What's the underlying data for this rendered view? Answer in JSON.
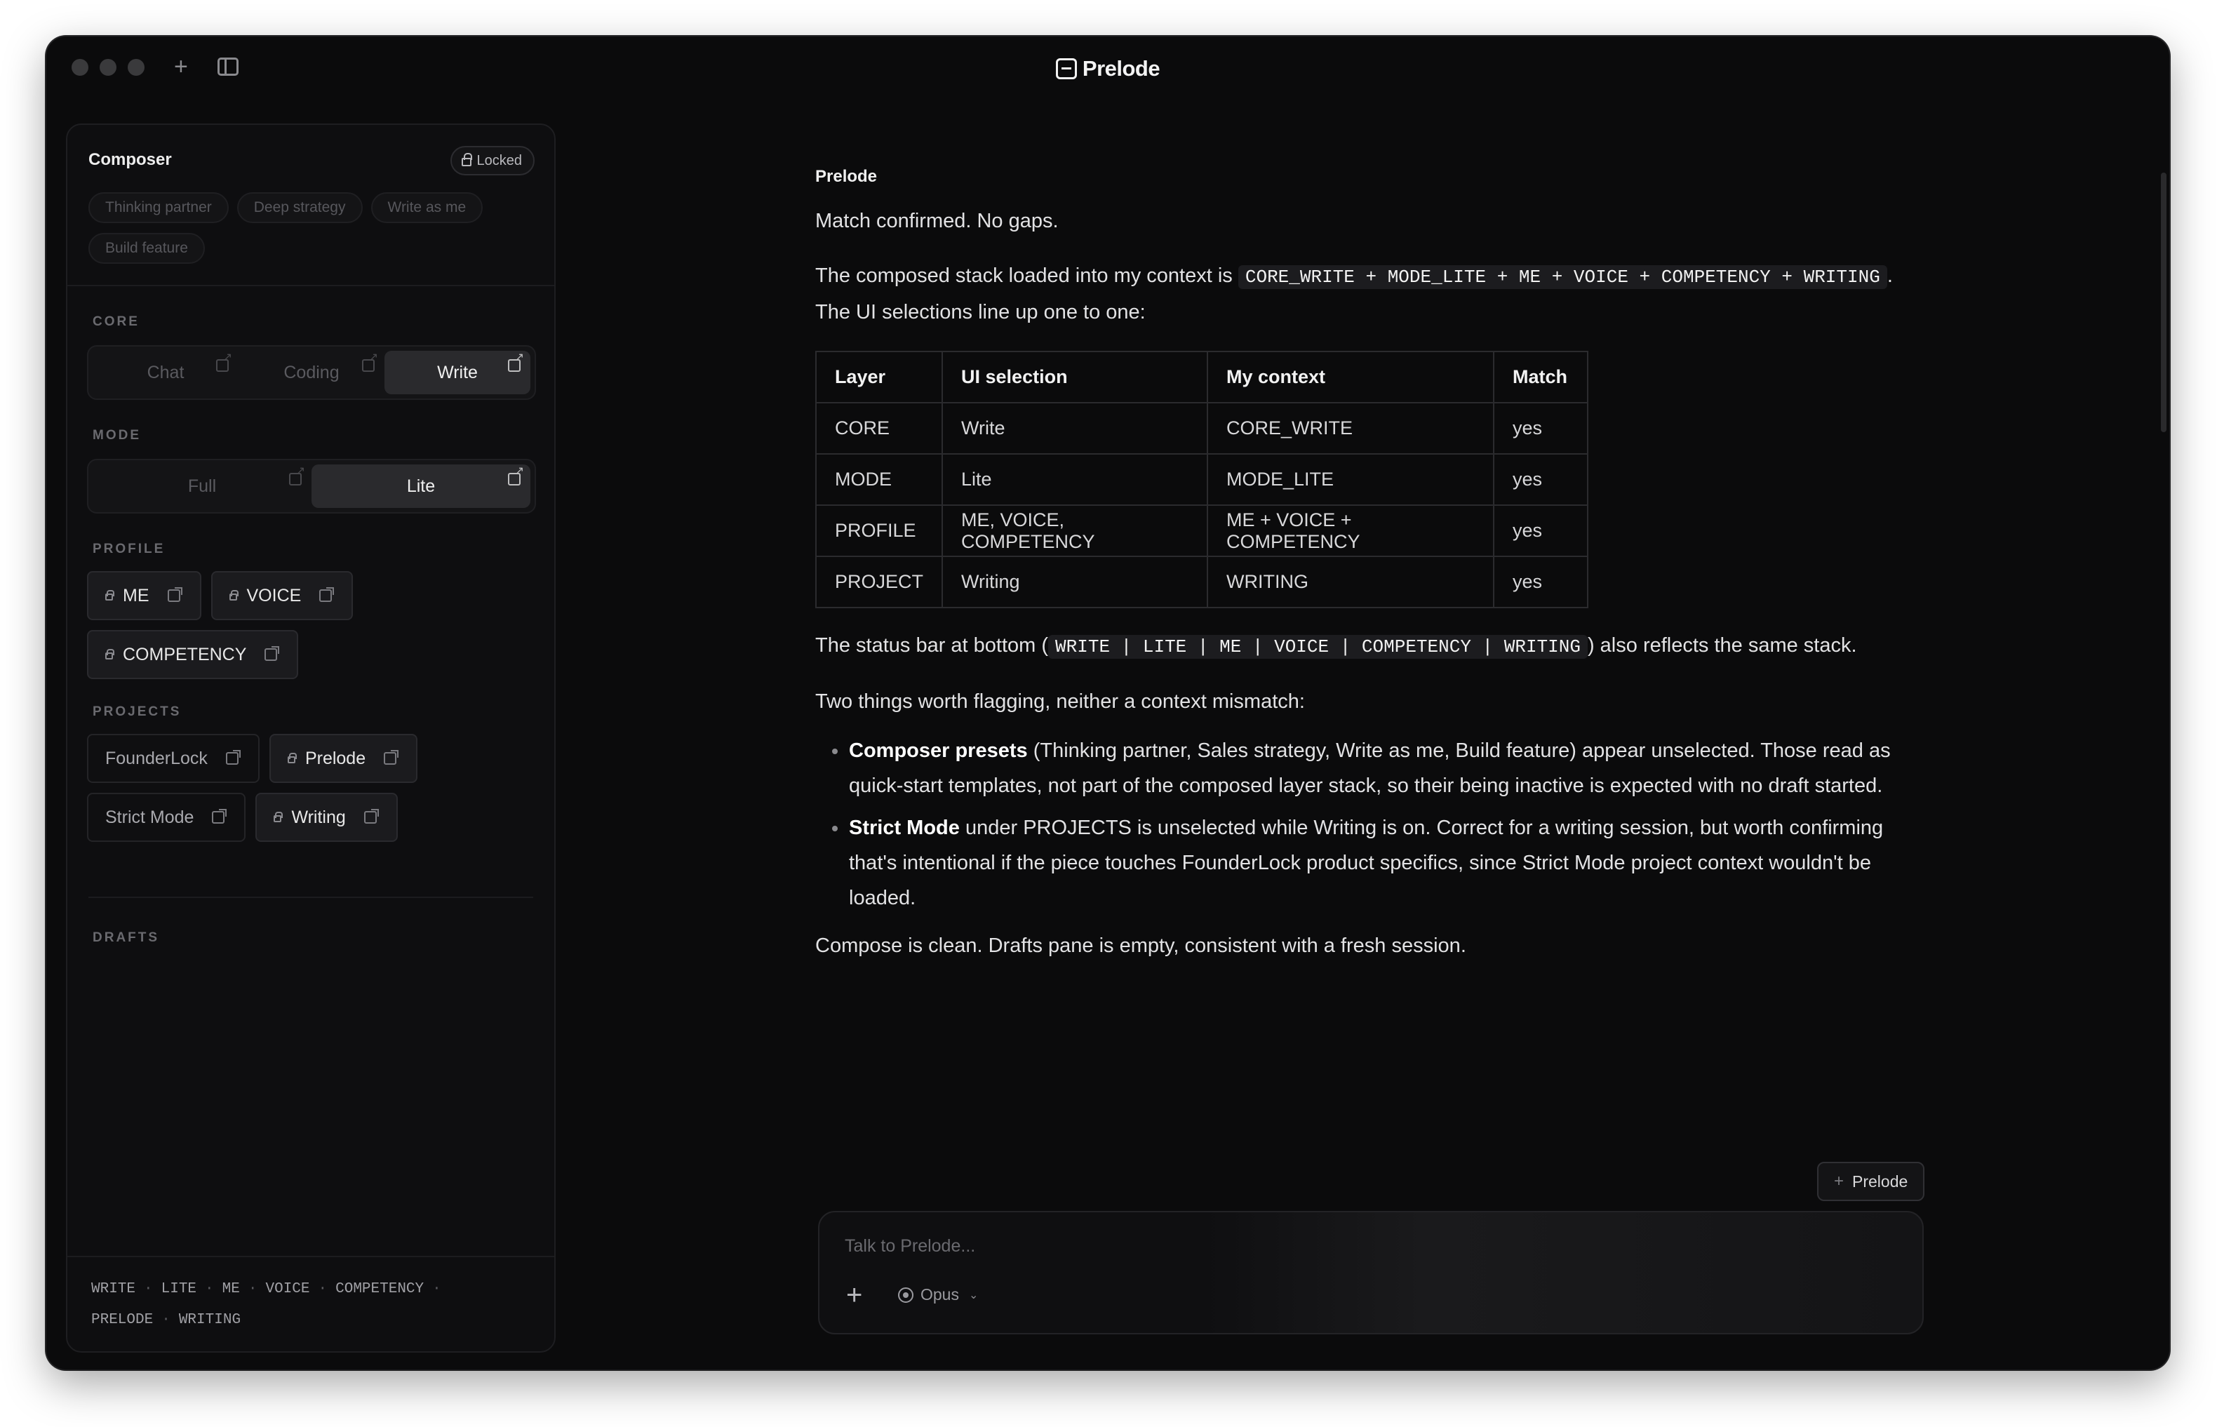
{
  "app": {
    "title": "Prelode"
  },
  "sidebar": {
    "composer_title": "Composer",
    "locked_label": "Locked",
    "presets": [
      "Thinking partner",
      "Deep strategy",
      "Write as me",
      "Build feature"
    ],
    "core": {
      "label": "CORE",
      "options": [
        {
          "label": "Chat",
          "active": false
        },
        {
          "label": "Coding",
          "active": false
        },
        {
          "label": "Write",
          "active": true
        }
      ]
    },
    "mode": {
      "label": "MODE",
      "options": [
        {
          "label": "Full",
          "active": false
        },
        {
          "label": "Lite",
          "active": true
        }
      ]
    },
    "profile": {
      "label": "PROFILE",
      "items": [
        {
          "label": "ME",
          "locked": true,
          "active": true
        },
        {
          "label": "VOICE",
          "locked": true,
          "active": true
        },
        {
          "label": "COMPETENCY",
          "locked": true,
          "active": true
        }
      ]
    },
    "projects": {
      "label": "PROJECTS",
      "items": [
        {
          "label": "FounderLock",
          "locked": false,
          "active": false
        },
        {
          "label": "Prelode",
          "locked": true,
          "active": true
        },
        {
          "label": "Strict Mode",
          "locked": false,
          "active": false
        },
        {
          "label": "Writing",
          "locked": true,
          "active": true
        }
      ]
    },
    "drafts_label": "DRAFTS",
    "status_line": [
      "WRITE",
      "LITE",
      "ME",
      "VOICE",
      "COMPETENCY",
      "PRELODE",
      "WRITING"
    ]
  },
  "message": {
    "sender": "Prelode",
    "p1": "Match confirmed. No gaps.",
    "p2_pre": "The composed stack loaded into my context is ",
    "p2_code": "CORE_WRITE + MODE_LITE + ME + VOICE + COMPETENCY + WRITING",
    "p2_post": ". The UI selections line up one to one:",
    "table": {
      "headers": [
        "Layer",
        "UI selection",
        "My context",
        "Match"
      ],
      "rows": [
        [
          "CORE",
          "Write",
          "CORE_WRITE",
          "yes"
        ],
        [
          "MODE",
          "Lite",
          "MODE_LITE",
          "yes"
        ],
        [
          "PROFILE",
          "ME, VOICE, COMPETENCY",
          "ME + VOICE + COMPETENCY",
          "yes"
        ],
        [
          "PROJECT",
          "Writing",
          "WRITING",
          "yes"
        ]
      ]
    },
    "p3_pre": "The status bar at bottom (",
    "p3_code": "WRITE | LITE | ME | VOICE | COMPETENCY | WRITING",
    "p3_post": ") also reflects the same stack.",
    "p4": "Two things worth flagging, neither a context mismatch:",
    "bullets": [
      {
        "bold": "Composer presets",
        "text": " (Thinking partner, Sales strategy, Write as me, Build feature) appear unselected. Those read as quick-start templates, not part of the composed layer stack, so their being inactive is expected with no draft started."
      },
      {
        "bold": "Strict Mode",
        "text": " under PROJECTS is unselected while Writing is on. Correct for a writing session, but worth confirming that's intentional if the piece touches FounderLock product specifics, since Strict Mode project context wouldn't be loaded."
      }
    ],
    "p5": "Compose is clean. Drafts pane is empty, consistent with a fresh session."
  },
  "composer": {
    "context_chip": "Prelode",
    "placeholder": "Talk to Prelode...",
    "model": "Opus"
  }
}
